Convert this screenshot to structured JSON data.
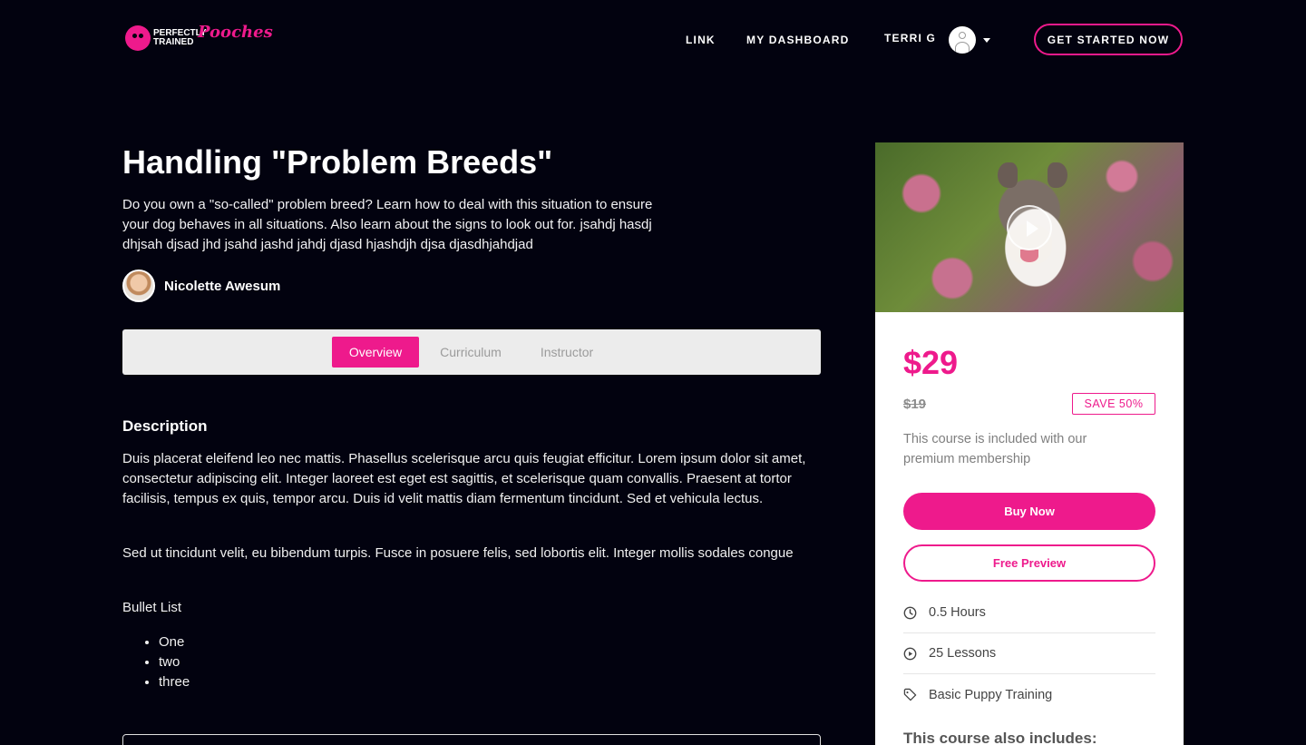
{
  "brand": {
    "line1": "PERFECTLY",
    "line2": "TRAINED",
    "script": "Pooches",
    "accent": "#ee1a8c"
  },
  "nav": {
    "link": "LINK",
    "dashboard": "MY DASHBOARD",
    "user_name": "TERRI G",
    "cta": "GET STARTED NOW"
  },
  "course": {
    "title": "Handling \"Problem Breeds\"",
    "subtitle": "Do you own a \"so-called\" problem breed? Learn how to deal with this situation to ensure your dog behaves in all situations. Also learn about the signs to look out for. jsahdj hasdj dhjsah djsad jhd jsahd jashd jahdj djasd hjashdjh djsa djasdhjahdjad",
    "instructor": "Nicolette Awesum"
  },
  "tabs": [
    {
      "label": "Overview",
      "active": true
    },
    {
      "label": "Curriculum",
      "active": false
    },
    {
      "label": "Instructor",
      "active": false
    }
  ],
  "description": {
    "heading": "Description",
    "p1": "Duis placerat eleifend leo nec mattis. Phasellus scelerisque arcu quis feugiat efficitur. Lorem ipsum dolor sit amet, consectetur adipiscing elit. Integer laoreet est eget est sagittis, et scelerisque quam convallis. Praesent at tortor facilisis, tempus ex quis, tempor arcu. Duis id velit mattis diam fermentum tincidunt. Sed et vehicula lectus.",
    "p2": "Sed ut tincidunt velit, eu bibendum turpis. Fusce in posuere felis, sed lobortis elit. Integer mollis sodales congue",
    "p3": "Bullet List",
    "bullets": [
      "One",
      "two",
      "three"
    ]
  },
  "sidebar": {
    "price": "$29",
    "old_price": "$19",
    "save": "SAVE 50%",
    "included": "This course is included with our premium membership",
    "buy": "Buy Now",
    "preview": "Free Preview",
    "hours": "0.5 Hours",
    "lessons": "25 Lessons",
    "category": "Basic Puppy Training",
    "also": "This course also includes:"
  }
}
